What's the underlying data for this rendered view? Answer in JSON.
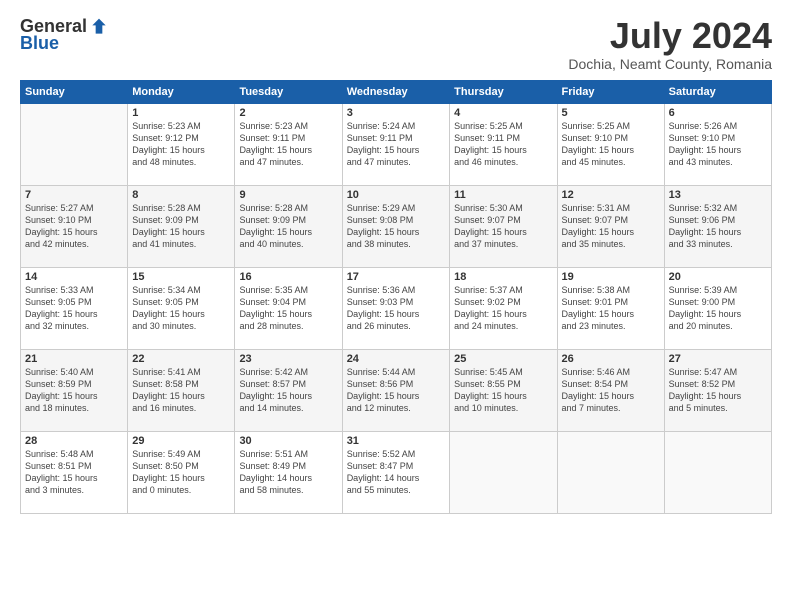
{
  "logo": {
    "general": "General",
    "blue": "Blue"
  },
  "title": {
    "month_year": "July 2024",
    "location": "Dochia, Neamt County, Romania"
  },
  "headers": [
    "Sunday",
    "Monday",
    "Tuesday",
    "Wednesday",
    "Thursday",
    "Friday",
    "Saturday"
  ],
  "weeks": [
    [
      {
        "day": "",
        "info": ""
      },
      {
        "day": "1",
        "info": "Sunrise: 5:23 AM\nSunset: 9:12 PM\nDaylight: 15 hours\nand 48 minutes."
      },
      {
        "day": "2",
        "info": "Sunrise: 5:23 AM\nSunset: 9:11 PM\nDaylight: 15 hours\nand 47 minutes."
      },
      {
        "day": "3",
        "info": "Sunrise: 5:24 AM\nSunset: 9:11 PM\nDaylight: 15 hours\nand 47 minutes."
      },
      {
        "day": "4",
        "info": "Sunrise: 5:25 AM\nSunset: 9:11 PM\nDaylight: 15 hours\nand 46 minutes."
      },
      {
        "day": "5",
        "info": "Sunrise: 5:25 AM\nSunset: 9:10 PM\nDaylight: 15 hours\nand 45 minutes."
      },
      {
        "day": "6",
        "info": "Sunrise: 5:26 AM\nSunset: 9:10 PM\nDaylight: 15 hours\nand 43 minutes."
      }
    ],
    [
      {
        "day": "7",
        "info": "Sunrise: 5:27 AM\nSunset: 9:10 PM\nDaylight: 15 hours\nand 42 minutes."
      },
      {
        "day": "8",
        "info": "Sunrise: 5:28 AM\nSunset: 9:09 PM\nDaylight: 15 hours\nand 41 minutes."
      },
      {
        "day": "9",
        "info": "Sunrise: 5:28 AM\nSunset: 9:09 PM\nDaylight: 15 hours\nand 40 minutes."
      },
      {
        "day": "10",
        "info": "Sunrise: 5:29 AM\nSunset: 9:08 PM\nDaylight: 15 hours\nand 38 minutes."
      },
      {
        "day": "11",
        "info": "Sunrise: 5:30 AM\nSunset: 9:07 PM\nDaylight: 15 hours\nand 37 minutes."
      },
      {
        "day": "12",
        "info": "Sunrise: 5:31 AM\nSunset: 9:07 PM\nDaylight: 15 hours\nand 35 minutes."
      },
      {
        "day": "13",
        "info": "Sunrise: 5:32 AM\nSunset: 9:06 PM\nDaylight: 15 hours\nand 33 minutes."
      }
    ],
    [
      {
        "day": "14",
        "info": "Sunrise: 5:33 AM\nSunset: 9:05 PM\nDaylight: 15 hours\nand 32 minutes."
      },
      {
        "day": "15",
        "info": "Sunrise: 5:34 AM\nSunset: 9:05 PM\nDaylight: 15 hours\nand 30 minutes."
      },
      {
        "day": "16",
        "info": "Sunrise: 5:35 AM\nSunset: 9:04 PM\nDaylight: 15 hours\nand 28 minutes."
      },
      {
        "day": "17",
        "info": "Sunrise: 5:36 AM\nSunset: 9:03 PM\nDaylight: 15 hours\nand 26 minutes."
      },
      {
        "day": "18",
        "info": "Sunrise: 5:37 AM\nSunset: 9:02 PM\nDaylight: 15 hours\nand 24 minutes."
      },
      {
        "day": "19",
        "info": "Sunrise: 5:38 AM\nSunset: 9:01 PM\nDaylight: 15 hours\nand 23 minutes."
      },
      {
        "day": "20",
        "info": "Sunrise: 5:39 AM\nSunset: 9:00 PM\nDaylight: 15 hours\nand 20 minutes."
      }
    ],
    [
      {
        "day": "21",
        "info": "Sunrise: 5:40 AM\nSunset: 8:59 PM\nDaylight: 15 hours\nand 18 minutes."
      },
      {
        "day": "22",
        "info": "Sunrise: 5:41 AM\nSunset: 8:58 PM\nDaylight: 15 hours\nand 16 minutes."
      },
      {
        "day": "23",
        "info": "Sunrise: 5:42 AM\nSunset: 8:57 PM\nDaylight: 15 hours\nand 14 minutes."
      },
      {
        "day": "24",
        "info": "Sunrise: 5:44 AM\nSunset: 8:56 PM\nDaylight: 15 hours\nand 12 minutes."
      },
      {
        "day": "25",
        "info": "Sunrise: 5:45 AM\nSunset: 8:55 PM\nDaylight: 15 hours\nand 10 minutes."
      },
      {
        "day": "26",
        "info": "Sunrise: 5:46 AM\nSunset: 8:54 PM\nDaylight: 15 hours\nand 7 minutes."
      },
      {
        "day": "27",
        "info": "Sunrise: 5:47 AM\nSunset: 8:52 PM\nDaylight: 15 hours\nand 5 minutes."
      }
    ],
    [
      {
        "day": "28",
        "info": "Sunrise: 5:48 AM\nSunset: 8:51 PM\nDaylight: 15 hours\nand 3 minutes."
      },
      {
        "day": "29",
        "info": "Sunrise: 5:49 AM\nSunset: 8:50 PM\nDaylight: 15 hours\nand 0 minutes."
      },
      {
        "day": "30",
        "info": "Sunrise: 5:51 AM\nSunset: 8:49 PM\nDaylight: 14 hours\nand 58 minutes."
      },
      {
        "day": "31",
        "info": "Sunrise: 5:52 AM\nSunset: 8:47 PM\nDaylight: 14 hours\nand 55 minutes."
      },
      {
        "day": "",
        "info": ""
      },
      {
        "day": "",
        "info": ""
      },
      {
        "day": "",
        "info": ""
      }
    ]
  ]
}
